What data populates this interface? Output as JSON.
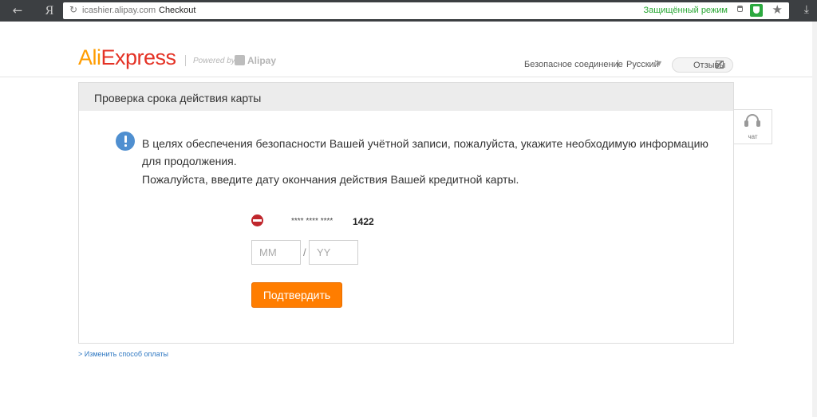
{
  "browser": {
    "back_glyph": "←",
    "yandex_glyph": "Я",
    "reload_glyph": "↻",
    "url": "icashier.alipay.com",
    "page_label": "Checkout",
    "secure_mode": "Защищённый режим",
    "star_glyph": "★",
    "download_glyph": "⤓"
  },
  "header": {
    "logo_ali": "Ali",
    "logo_express": "Express",
    "powered_by": "Powered by",
    "alipay": "Alipay",
    "secure_connection": "Безопасное соединение",
    "separator": "|",
    "language": "Русский",
    "language_chevron": "▼",
    "feedback": "Отзывы"
  },
  "panel": {
    "title": "Проверка срока действия карты",
    "message_line1": "В целях обеспечения безопасности Вашей учётной записи, пожалуйста, укажите необходимую информацию для продолжения.",
    "message_line2": "Пожалуйста, введите дату окончания действия Вашей кредитной карты.",
    "card_mask": "**** **** ****",
    "card_last4": "1422",
    "month_placeholder": "MM",
    "year_placeholder": "YY",
    "slash": "/",
    "confirm": "Подтвердить"
  },
  "chat": {
    "label": "чат"
  },
  "footer": {
    "change_payment": "> Изменить способ оплаты"
  },
  "colors": {
    "accent": "#ff7d00",
    "ali": "#ff9c00",
    "express": "#e43225",
    "secure": "#27a633",
    "link": "#2f78c2"
  }
}
